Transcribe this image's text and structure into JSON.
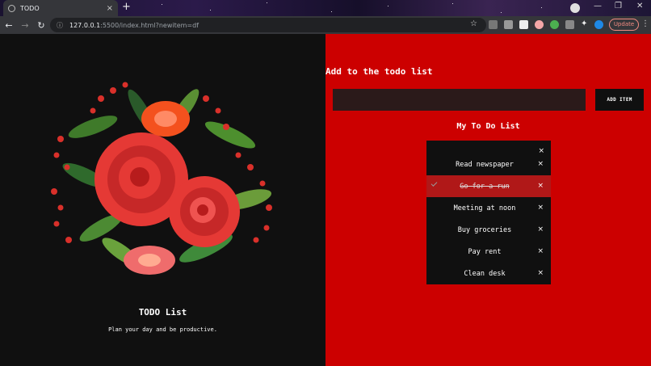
{
  "browser": {
    "tab_title": "TODO",
    "tab_close": "×",
    "new_tab": "+",
    "url_host": "127.0.0.1",
    "url_rest": ":5500/index.html?newitem=df",
    "update_label": "Update",
    "window_minimize": "—",
    "window_restore": "❐",
    "window_close": "✕"
  },
  "left": {
    "title": "TODO List",
    "subtitle": "Plan your day and be productive."
  },
  "right": {
    "add_heading": "Add to the todo list",
    "input_value": "",
    "add_button_label": "ADD ITEM",
    "list_heading": "My To Do List",
    "box_close": "×",
    "items": [
      {
        "text": "Read newspaper",
        "checked": false,
        "close": "×"
      },
      {
        "text": "Go for a run",
        "checked": true,
        "close": "×"
      },
      {
        "text": "Meeting at noon",
        "checked": false,
        "close": "×"
      },
      {
        "text": "Buy groceries",
        "checked": false,
        "close": "×"
      },
      {
        "text": "Pay rent",
        "checked": false,
        "close": "×"
      },
      {
        "text": "Clean desk",
        "checked": false,
        "close": "×"
      }
    ]
  },
  "colors": {
    "accent_red": "#cc0000",
    "checked_row": "#b01818",
    "dark": "#101010"
  },
  "icons": {
    "bouquet": "rose-bouquet-image",
    "check": "check-icon",
    "close": "close-icon"
  }
}
